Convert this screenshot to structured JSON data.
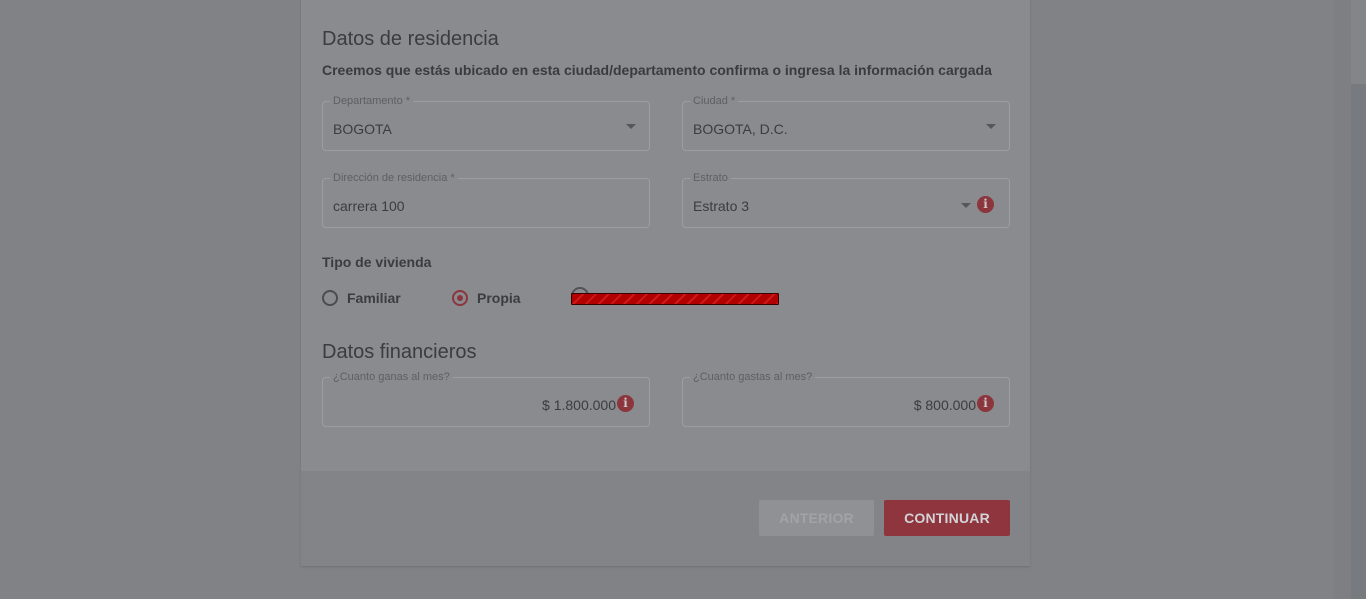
{
  "residence": {
    "title": "Datos de residencia",
    "subtitle": "Creemos que estás ubicado en esta ciudad/departamento confirma o ingresa la información cargada",
    "departamento": {
      "label": "Departamento *",
      "value": "BOGOTA"
    },
    "ciudad": {
      "label": "Ciudad *",
      "value": "BOGOTA, D.C."
    },
    "direccion": {
      "label": "Dirección de residencia *",
      "value": "carrera 100"
    },
    "estrato": {
      "label": "Estrato",
      "value": "Estrato 3"
    }
  },
  "housing": {
    "label": "Tipo de vivienda",
    "options": [
      {
        "label": "Familiar",
        "selected": false
      },
      {
        "label": "Propia",
        "selected": true
      }
    ]
  },
  "financial": {
    "title": "Datos financieros",
    "income": {
      "label": "¿Cuanto ganas al mes?",
      "value": "$ 1.800.000"
    },
    "expenses": {
      "label": "¿Cuanto gastas al mes?",
      "value": "$ 800.000"
    }
  },
  "actions": {
    "prev_label": "ANTERIOR",
    "next_label": "CONTINUAR"
  },
  "colors": {
    "accent": "#e4505e",
    "overlay": "#808286"
  },
  "icons": {
    "info": "info-icon",
    "dropdown": "chevron-down-icon"
  }
}
